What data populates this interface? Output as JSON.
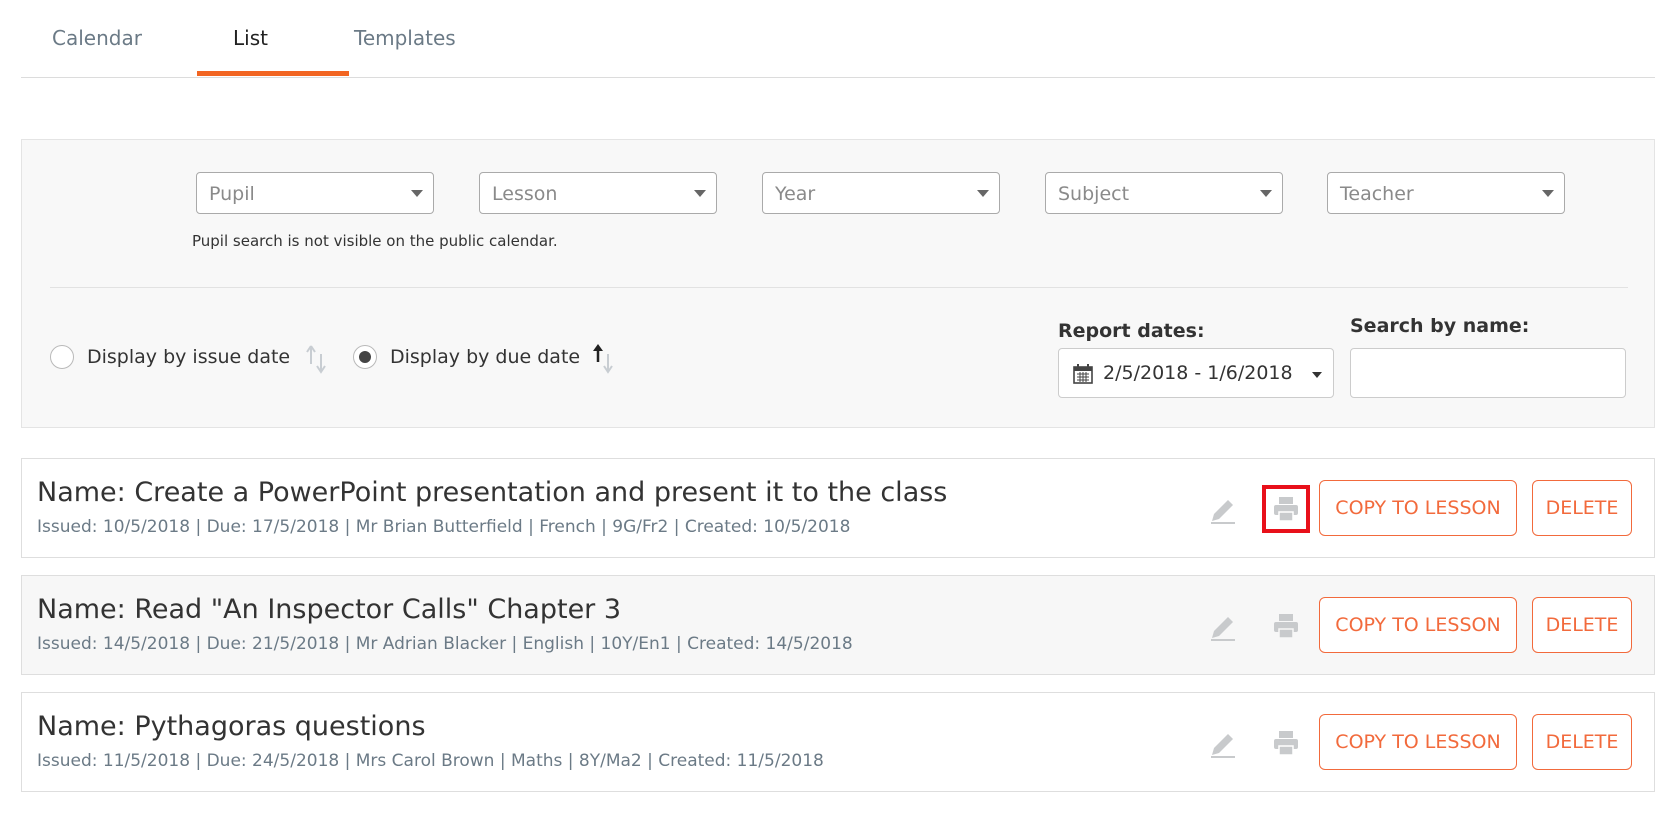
{
  "tabs": [
    {
      "label": "Calendar",
      "active": false
    },
    {
      "label": "List",
      "active": true
    },
    {
      "label": "Templates",
      "active": false
    }
  ],
  "accent_color": "#f26522",
  "filters": {
    "selects": [
      {
        "placeholder": "Pupil"
      },
      {
        "placeholder": "Lesson"
      },
      {
        "placeholder": "Year"
      },
      {
        "placeholder": "Subject"
      },
      {
        "placeholder": "Teacher"
      }
    ],
    "pupil_note": "Pupil search is not visible on the public calendar.",
    "radios": [
      {
        "label": "Display by issue date",
        "checked": false
      },
      {
        "label": "Display by due date",
        "checked": true
      }
    ],
    "report_dates_label": "Report dates:",
    "report_dates_value": "2/5/2018 - 1/6/2018",
    "search_label": "Search by name:",
    "search_value": ""
  },
  "items": [
    {
      "title": "Name: Create a PowerPoint presentation and present it to the class",
      "meta": "Issued: 10/5/2018 | Due: 17/5/2018 | Mr Brian Butterfield | French | 9G/Fr2 | Created: 10/5/2018",
      "copy_label": "COPY TO LESSON",
      "delete_label": "DELETE",
      "print_highlighted": true
    },
    {
      "title": "Name: Read \"An Inspector Calls\" Chapter 3",
      "meta": "Issued: 14/5/2018 | Due: 21/5/2018 | Mr Adrian Blacker | English | 10Y/En1 | Created: 14/5/2018",
      "copy_label": "COPY TO LESSON",
      "delete_label": "DELETE",
      "print_highlighted": false
    },
    {
      "title": "Name: Pythagoras questions",
      "meta": "Issued: 11/5/2018 | Due: 24/5/2018 | Mrs Carol Brown | Maths | 8Y/Ma2 | Created: 11/5/2018",
      "copy_label": "COPY TO LESSON",
      "delete_label": "DELETE",
      "print_highlighted": false
    }
  ],
  "icons": {
    "edit": "pencil-icon",
    "print": "printer-icon",
    "calendar": "calendar-icon",
    "sort": "sort-arrows-icon"
  }
}
